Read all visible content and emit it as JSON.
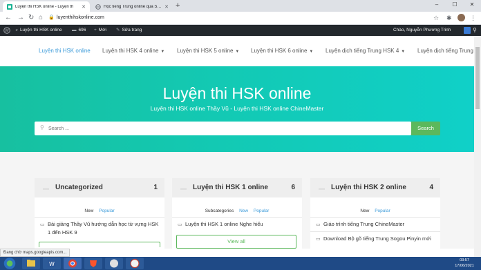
{
  "browser": {
    "tabs": [
      {
        "title": "Luyện thi HSK online - Luyện th",
        "active": true
      },
      {
        "title": "Học tiếng Trung online qua Skyp",
        "active": false
      }
    ],
    "new_tab": "+",
    "url": "luyenthihskonline.com",
    "window_controls": [
      "–",
      "☐",
      "✕"
    ]
  },
  "wp_admin_bar": {
    "site_name": "Luyện thi HSK online",
    "comments_count": "696",
    "new_label": "Mới",
    "edit_label": "Sửa trang",
    "greeting": "Chào, Nguyễn Phương Trinh"
  },
  "site_nav": {
    "items": [
      {
        "label": "Luyện thi HSK online",
        "current": true,
        "dropdown": false
      },
      {
        "label": "Luyện thi HSK 4 online",
        "current": false,
        "dropdown": true
      },
      {
        "label": "Luyện thi HSK 5 online",
        "current": false,
        "dropdown": true
      },
      {
        "label": "Luyện thi HSK 6 online",
        "current": false,
        "dropdown": true
      },
      {
        "label": "Luyện dịch tiếng Trung HSK 4",
        "current": false,
        "dropdown": true
      },
      {
        "label": "Luyện dịch tiếng Trung",
        "current": false,
        "dropdown": false
      }
    ]
  },
  "hero": {
    "title": "Luyện thi HSK online",
    "subtitle": "Luyện thi HSK online Thầy Vũ - Luyện thi HSK online ChineMaster",
    "search_placeholder": "Search ...",
    "search_button": "Search"
  },
  "cards": [
    {
      "title": "Uncategorized",
      "count": "1",
      "tabs": [
        "New",
        "Popular"
      ],
      "rows": [
        "Bài giảng Thầy Vũ hướng dẫn học từ vựng HSK 1 đến HSK 9"
      ]
    },
    {
      "title": "Luyện thi HSK 1 online",
      "count": "6",
      "tabs": [
        "Subcategories",
        "New",
        "Popular"
      ],
      "rows": [
        "Luyện thi HSK 1 online Nghe hiểu"
      ],
      "view_all": "View all"
    },
    {
      "title": "Luyện thi HSK 2 online",
      "count": "4",
      "tabs": [
        "New",
        "Popular"
      ],
      "rows": [
        "Giáo trình tiếng Trung ChineMaster",
        "Download Bộ gõ tiếng Trung Sogou Pinyin mới"
      ]
    }
  ],
  "status_bar": "Đang chờ maps.googleapis.com...",
  "taskbar": {
    "time": "03:57",
    "date": "17/06/2021"
  },
  "colors": {
    "hero_start": "#17c0a0",
    "hero_end": "#10d0c8",
    "accent_green": "#5cb85c",
    "link_blue": "#3a9ad9",
    "wp_bar": "#23282d"
  }
}
